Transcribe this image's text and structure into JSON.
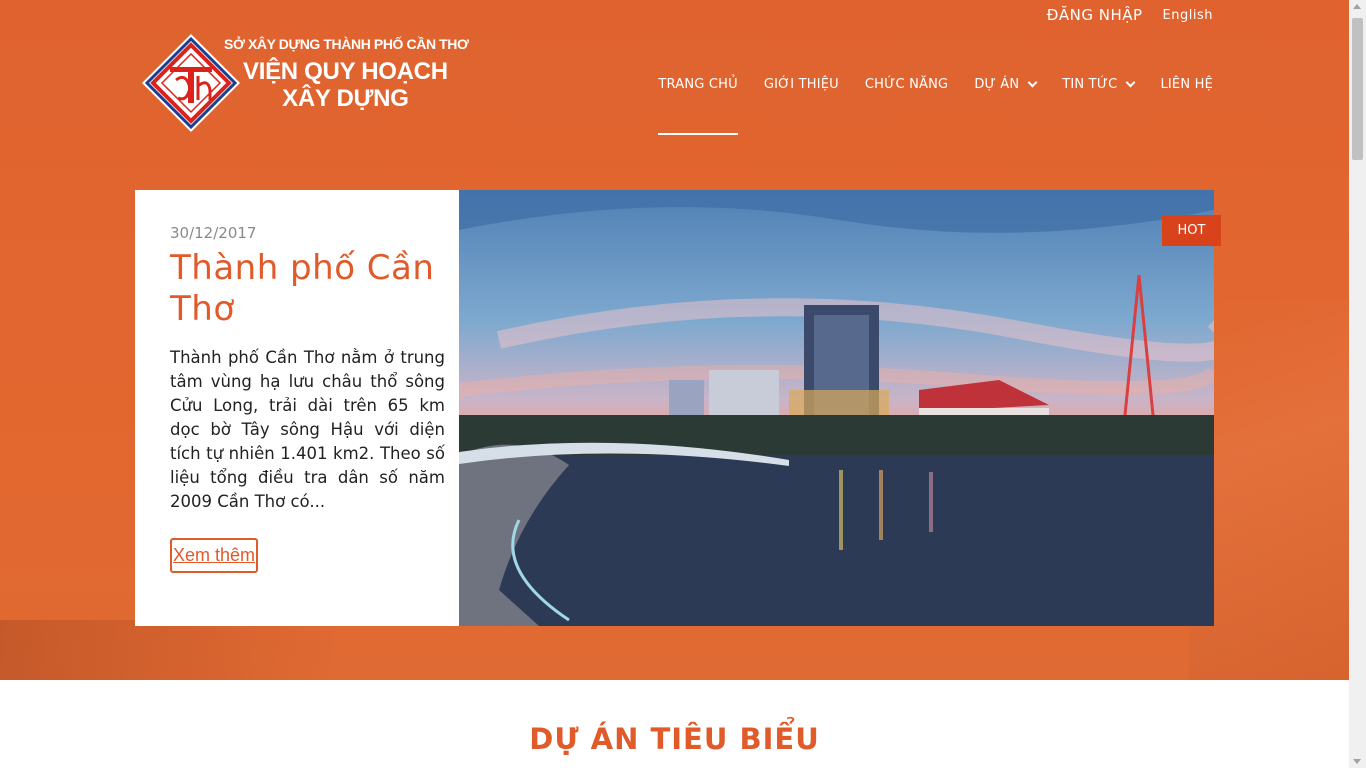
{
  "topbar": {
    "login": "ĐĂNG NHẬP",
    "language": "English"
  },
  "logo": {
    "agency": "SỞ XÂY DỰNG THÀNH PHỐ CẦN THƠ",
    "name_line1": "VIỆN QUY HOẠCH",
    "name_line2": "XÂY DỰNG"
  },
  "nav": {
    "items": [
      {
        "label": "TRANG CHỦ",
        "active": true
      },
      {
        "label": "GIỚI THIỆU"
      },
      {
        "label": "CHỨC NĂNG"
      },
      {
        "label": "DỰ ÁN",
        "has_dropdown": true
      },
      {
        "label": "TIN TỨC",
        "has_dropdown": true
      },
      {
        "label": "LIÊN HỆ"
      }
    ]
  },
  "featured": {
    "date": "30/12/2017",
    "title": "Thành phố Cần Thơ",
    "excerpt": "Thành phố Cần Thơ nằm ở trung tâm vùng hạ lưu châu thổ sông Cửu Long, trải dài trên 65 km dọc bờ Tây sông Hậu với diện tích tự nhiên 1.401 km2. Theo số liệu tổng điều tra dân số năm 2009 Cần Thơ có...",
    "read_more": "Xem thêm",
    "badge": "HOT"
  },
  "section": {
    "title": "DỰ ÁN TIÊU BIỂU"
  },
  "colors": {
    "brand_orange": "#e0632f",
    "accent_red": "#d9431b",
    "text_orange": "#e05a2a"
  }
}
